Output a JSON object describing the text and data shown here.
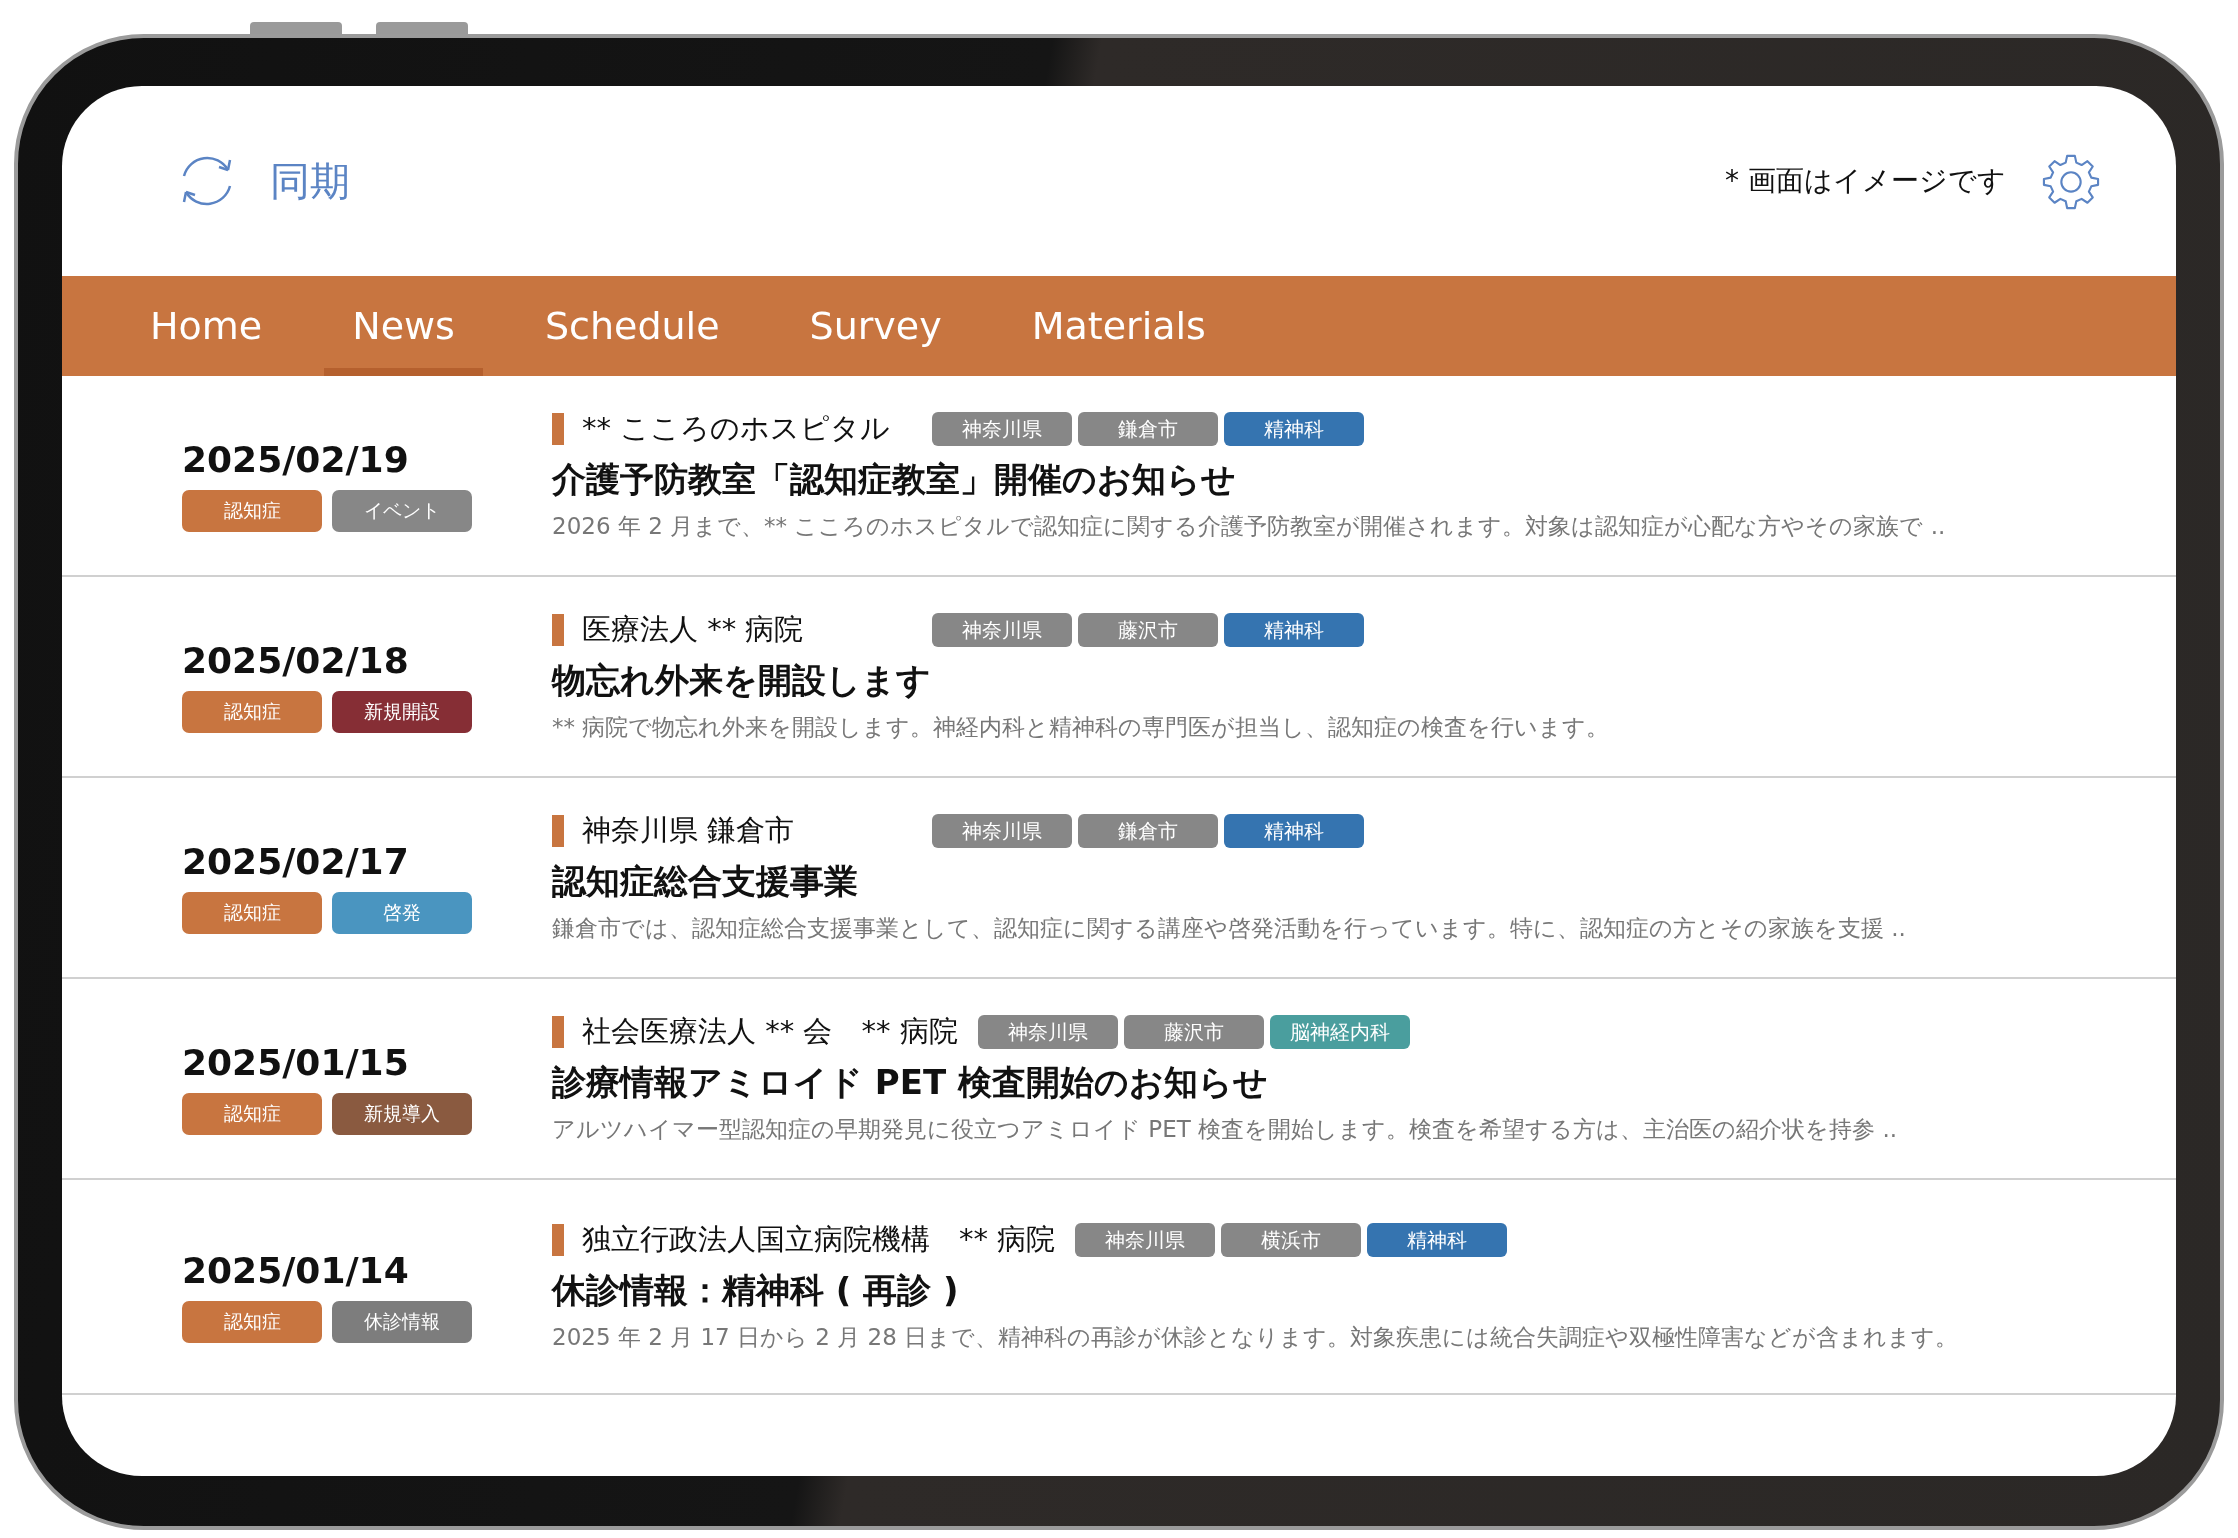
{
  "header": {
    "sync_label": "同期",
    "note": "* 画面はイメージです"
  },
  "nav": [
    {
      "label": "Home",
      "selected": false
    },
    {
      "label": "News",
      "selected": true
    },
    {
      "label": "Schedule",
      "selected": false
    },
    {
      "label": "Survey",
      "selected": false
    },
    {
      "label": "Materials",
      "selected": false
    }
  ],
  "news": [
    {
      "date": "2025/02/19",
      "categories": [
        {
          "label": "認知症",
          "color": "#c87540"
        },
        {
          "label": "イベント",
          "color": "#878787"
        }
      ],
      "source": "** こころのホスピタル",
      "tags": [
        {
          "label": "神奈川県",
          "color": "#878787"
        },
        {
          "label": "鎌倉市",
          "color": "#878787"
        },
        {
          "label": "精神科",
          "color": "#3574b0"
        }
      ],
      "title": "介護予防教室「認知症教室」開催のお知らせ",
      "summary": "2026 年 2 月まで、** こころのホスピタルで認知症に関する介護予防教室が開催されます。対象は認知症が心配な方やその家族で .."
    },
    {
      "date": "2025/02/18",
      "categories": [
        {
          "label": "認知症",
          "color": "#c87540"
        },
        {
          "label": "新規開設",
          "color": "#862e35"
        }
      ],
      "source": "医療法人 ** 病院",
      "tags": [
        {
          "label": "神奈川県",
          "color": "#878787"
        },
        {
          "label": "藤沢市",
          "color": "#878787"
        },
        {
          "label": "精神科",
          "color": "#3574b0"
        }
      ],
      "title": "物忘れ外来を開設します",
      "summary": "** 病院で物忘れ外来を開設します。神経内科と精神科の専門医が担当し、認知症の検査を行います。"
    },
    {
      "date": "2025/02/17",
      "categories": [
        {
          "label": "認知症",
          "color": "#c87540"
        },
        {
          "label": "啓発",
          "color": "#4a95c0"
        }
      ],
      "source": "神奈川県 鎌倉市",
      "tags": [
        {
          "label": "神奈川県",
          "color": "#878787"
        },
        {
          "label": "鎌倉市",
          "color": "#878787"
        },
        {
          "label": "精神科",
          "color": "#3574b0"
        }
      ],
      "title": "認知症総合支援事業",
      "summary": "鎌倉市では、認知症総合支援事業として、認知症に関する講座や啓発活動を行っています。特に、認知症の方とその家族を支援 .."
    },
    {
      "date": "2025/01/15",
      "categories": [
        {
          "label": "認知症",
          "color": "#c87540"
        },
        {
          "label": "新規導入",
          "color": "#8a5a40"
        }
      ],
      "source": "社会医療法人 ** 会　** 病院",
      "tags": [
        {
          "label": "神奈川県",
          "color": "#878787"
        },
        {
          "label": "藤沢市",
          "color": "#878787"
        },
        {
          "label": "脳神経内科",
          "color": "#4a9e9e"
        }
      ],
      "title": "診療情報アミロイド PET 検査開始のお知らせ",
      "summary": "アルツハイマー型認知症の早期発見に役立つアミロイド PET 検査を開始します。検査を希望する方は、主治医の紹介状を持参 .."
    },
    {
      "date": "2025/01/14",
      "categories": [
        {
          "label": "認知症",
          "color": "#c87540"
        },
        {
          "label": "休診情報",
          "color": "#7d7d7d"
        }
      ],
      "source": "独立行政法人国立病院機構　** 病院",
      "tags": [
        {
          "label": "神奈川県",
          "color": "#878787"
        },
        {
          "label": "横浜市",
          "color": "#878787"
        },
        {
          "label": "精神科",
          "color": "#3574b0"
        }
      ],
      "title": "休診情報：精神科 ( 再診 )",
      "summary": "2025 年 2 月 17 日から 2 月 28 日まで、精神科の再診が休診となります。対象疾患には統合失調症や双極性障害などが含まれます。"
    }
  ]
}
